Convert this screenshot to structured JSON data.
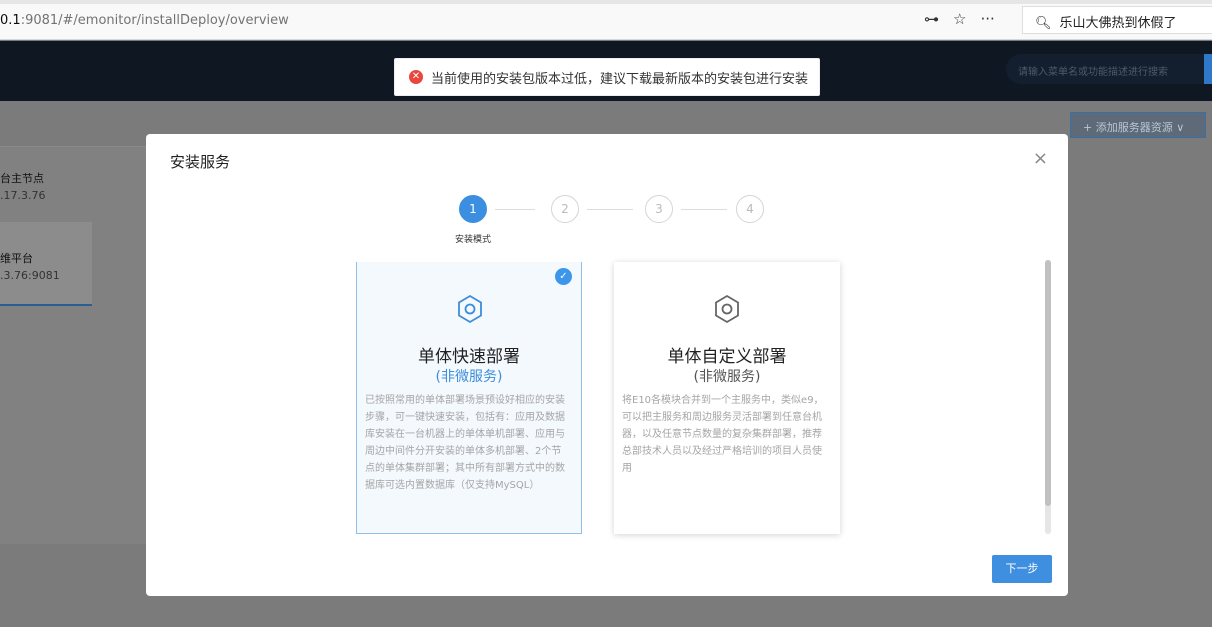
{
  "browser": {
    "url_host": "0.1",
    "url_rest": ":9081/#/emonitor/installDeploy/overview",
    "search_text": "乐山大佛热到休假了"
  },
  "app": {
    "search_placeholder": "请输入菜单名或功能描述进行搜索",
    "add_button": "+ 添加服务器资源 ∨"
  },
  "sidebar": {
    "node1": {
      "title": "台主节点",
      "sub": ".17.3.76"
    },
    "node2": {
      "title": "维平台",
      "sub": ".3.76:9081"
    }
  },
  "toast": {
    "icon": "error-icon",
    "message": "当前使用的安装包版本过低，建议下载最新版本的安装包进行安装"
  },
  "modal": {
    "title": "安装服务",
    "close": "×",
    "steps": [
      {
        "num": "1",
        "label": "安装模式",
        "active": true
      },
      {
        "num": "2"
      },
      {
        "num": "3"
      },
      {
        "num": "4"
      }
    ],
    "cards": [
      {
        "title": "单体快速部署",
        "subtitle": "(非微服务)",
        "selected": true,
        "description": "已按照常用的单体部署场景预设好相应的安装步骤，可一键快速安装，包括有：应用及数据库安装在一台机器上的单体单机部署、应用与周边中间件分开安装的单体多机部署、2个节点的单体集群部署；其中所有部署方式中的数据库可选内置数据库（仅支持MySQL）"
      },
      {
        "title": "单体自定义部署",
        "subtitle": "(非微服务)",
        "selected": false,
        "description": "将E10各模块合并到一个主服务中，类似e9，可以把主服务和周边服务灵活部署到任意台机器，以及任意节点数量的复杂集群部署，推荐总部技术人员以及经过严格培训的项目人员使用"
      }
    ],
    "next_button": "下一步"
  }
}
